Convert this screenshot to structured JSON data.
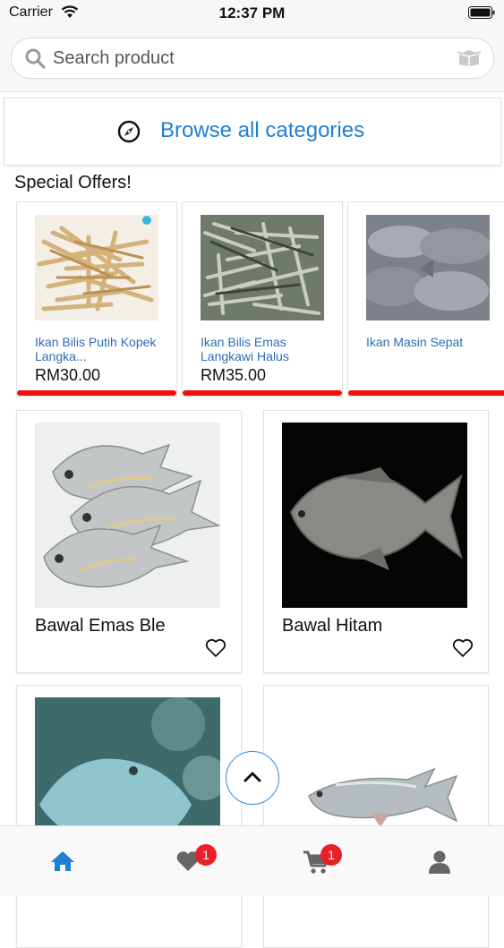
{
  "status_bar": {
    "carrier": "Carrier",
    "time": "12:37 PM"
  },
  "search": {
    "placeholder": "Search product",
    "value": ""
  },
  "browse": {
    "label": "Browse all categories"
  },
  "special_offers": {
    "title": "Special Offers!",
    "items": [
      {
        "name": "Ikan Bilis Putih Kopek Langka...",
        "price": "RM30.00"
      },
      {
        "name": "Ikan Bilis Emas Langkawi Halus",
        "price": "RM35.00"
      },
      {
        "name": "Ikan Masin Sepat",
        "price": ""
      }
    ]
  },
  "products": [
    {
      "name": "Bawal Emas Ble"
    },
    {
      "name": "Bawal Hitam"
    },
    {
      "name": ""
    },
    {
      "name": ""
    }
  ],
  "tab_bar": {
    "active": "home",
    "wishlist_badge": "1",
    "cart_badge": "1"
  },
  "colors": {
    "accent": "#1f7fd1",
    "badge": "#e8202a",
    "offer_bar": "#ee1111"
  }
}
